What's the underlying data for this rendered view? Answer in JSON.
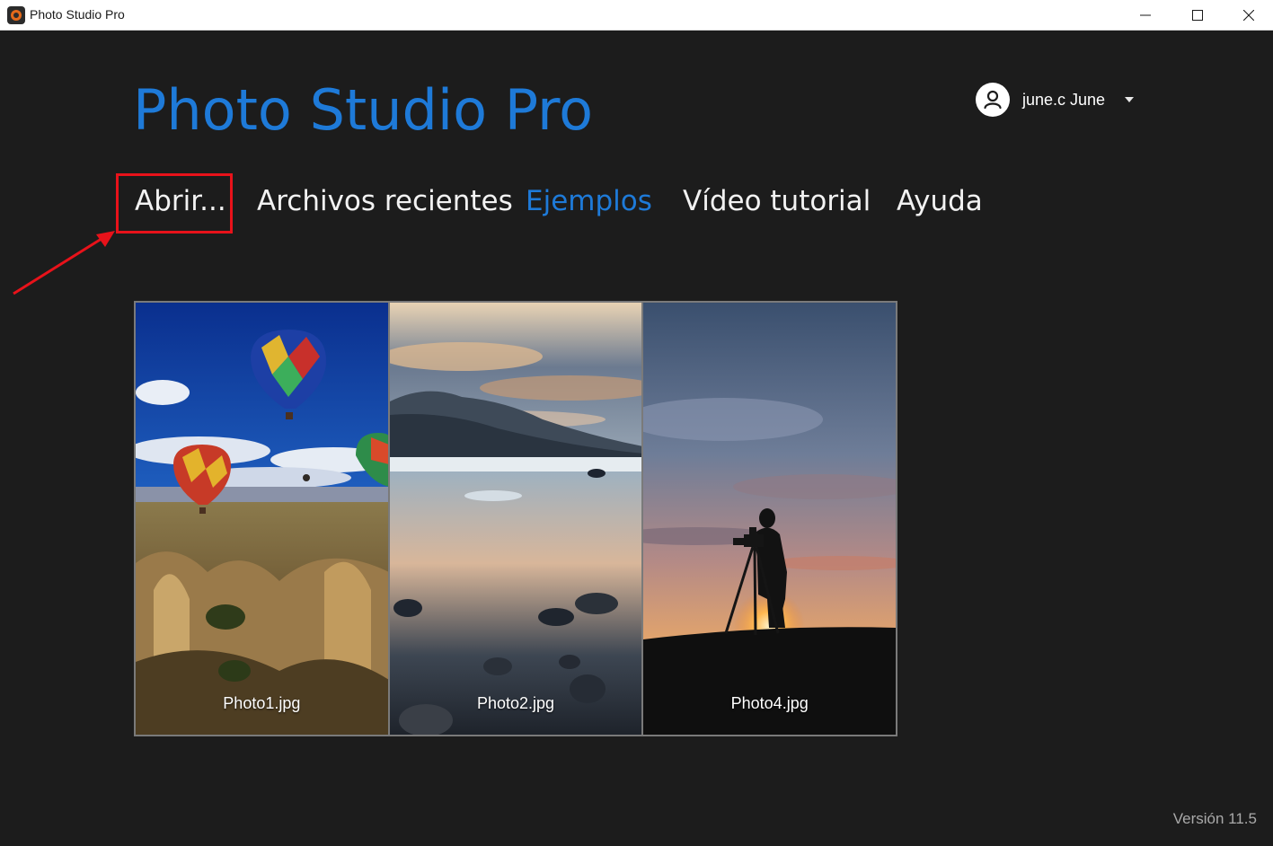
{
  "window": {
    "title": "Photo Studio Pro"
  },
  "header": {
    "brand": "Photo Studio Pro",
    "user_name": "june.c June"
  },
  "nav": {
    "items": [
      {
        "label": "Abrir..."
      },
      {
        "label": "Archivos recientes"
      },
      {
        "label": "Ejemplos",
        "active": true
      },
      {
        "label": "Vídeo tutorial"
      },
      {
        "label": "Ayuda"
      }
    ]
  },
  "gallery": {
    "items": [
      {
        "label": "Photo1.jpg"
      },
      {
        "label": "Photo2.jpg"
      },
      {
        "label": "Photo4.jpg"
      }
    ]
  },
  "footer": {
    "version": "Versión 11.5"
  },
  "colors": {
    "accent": "#1e7ad8",
    "background": "#1c1c1c",
    "highlight": "#e8121a"
  },
  "icons": {
    "app": "app-logo-icon",
    "user": "user-avatar-icon",
    "dropdown": "caret-down-icon",
    "minimize": "minimize-icon",
    "maximize": "maximize-icon",
    "close": "close-icon"
  }
}
